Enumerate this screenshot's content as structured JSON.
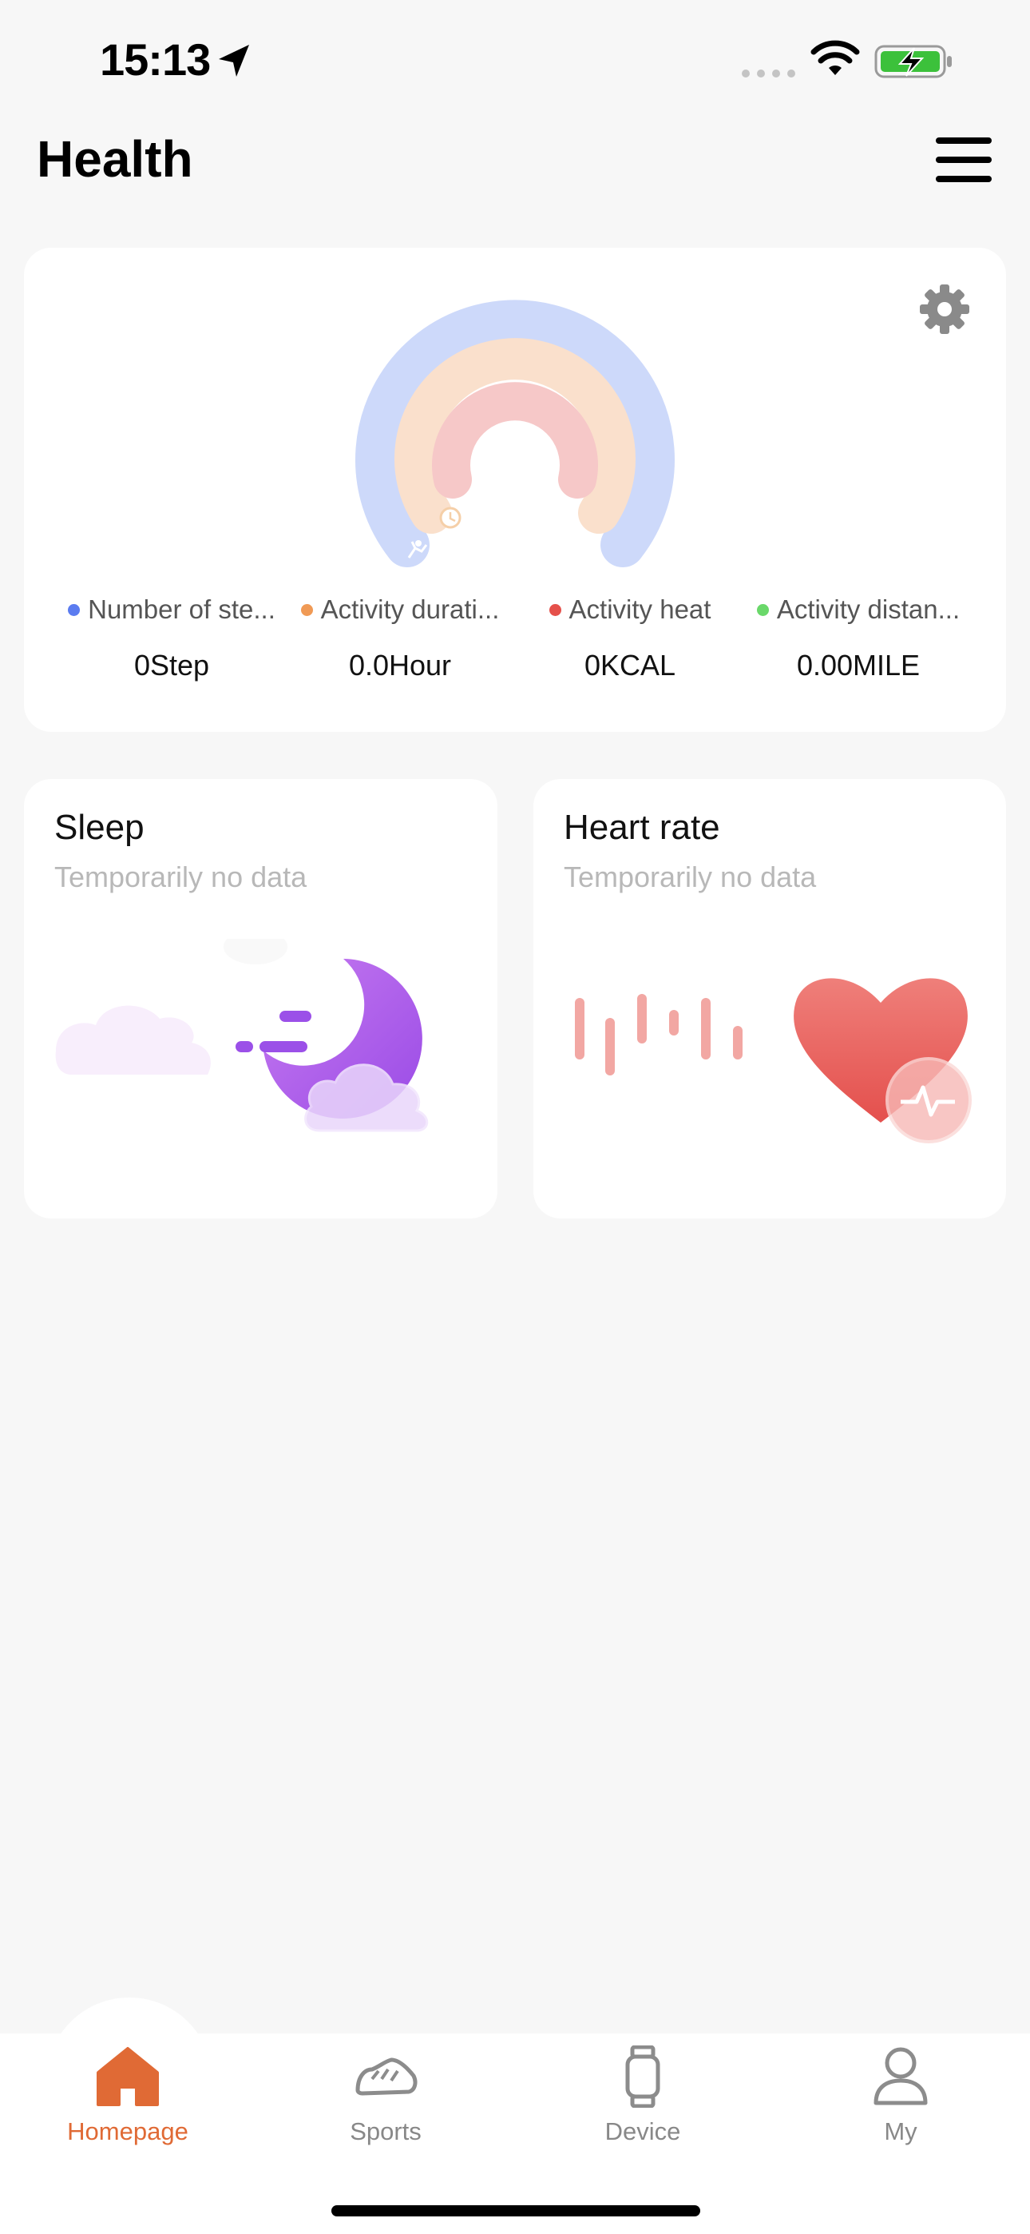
{
  "status_bar": {
    "time": "15:13"
  },
  "header": {
    "title": "Health"
  },
  "summary": {
    "metrics": [
      {
        "label": "Number of ste...",
        "value": "0Step",
        "color": "#5b7cf0"
      },
      {
        "label": "Activity durati...",
        "value": "0.0Hour",
        "color": "#f09a55"
      },
      {
        "label": "Activity heat",
        "value": "0KCAL",
        "color": "#e5504a"
      },
      {
        "label": "Activity distan...",
        "value": "0.00MILE",
        "color": "#6ad86a"
      }
    ],
    "ring_colors": [
      "#cdd9fa",
      "#fae0cc",
      "#f6c8c8"
    ]
  },
  "cards": {
    "sleep": {
      "title": "Sleep",
      "subtitle": "Temporarily no data"
    },
    "heart": {
      "title": "Heart rate",
      "subtitle": "Temporarily no data"
    }
  },
  "tabs": [
    {
      "label": "Homepage",
      "icon": "home-icon",
      "active": true
    },
    {
      "label": "Sports",
      "icon": "shoe-icon",
      "active": false
    },
    {
      "label": "Device",
      "icon": "watch-icon",
      "active": false
    },
    {
      "label": "My",
      "icon": "person-icon",
      "active": false
    }
  ],
  "colors": {
    "accent": "#e06a35",
    "background": "#f7f7f7"
  }
}
